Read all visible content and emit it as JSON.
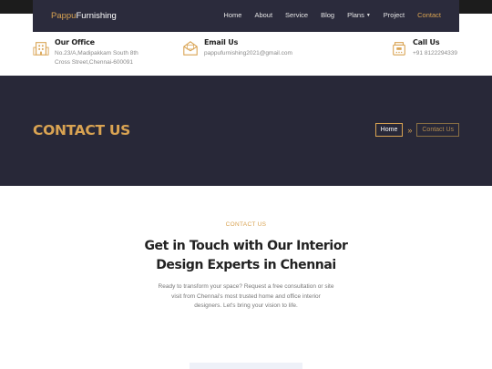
{
  "nav": {
    "brand_part1": "Pappu",
    "brand_part2": "Furnishing",
    "items": [
      "Home",
      "About",
      "Service",
      "Blog",
      "Plans",
      "Project",
      "Contact"
    ],
    "active": "Contact"
  },
  "info": {
    "office": {
      "title": "Our Office",
      "line1": "No.23/A,Madipakkam South 8th",
      "line2": "Cross Street,Chennai-600091",
      "icon": "building-icon"
    },
    "email": {
      "title": "Email Us",
      "value": "pappufurnishing2021@gmail.com",
      "icon": "envelope-icon"
    },
    "call": {
      "title": "Call Us",
      "value": "+91 8122294339",
      "icon": "phone-icon"
    }
  },
  "hero": {
    "title": "CONTACT US",
    "breadcrumb": [
      "Home",
      "Contact Us"
    ]
  },
  "section": {
    "tag": "CONTACT US",
    "title_line1": "Get in Touch with Our Interior",
    "title_line2": "Design Experts in Chennai",
    "body_lines": [
      "Ready to transform your space? Request a free consultation or site",
      "visit from Chennai's most trusted home and office interior",
      "designers. Let's bring your vision to life."
    ]
  },
  "colors": {
    "accent": "#d9a352",
    "navbar_bg": "#2b2b3c",
    "hero_bg": "#282838"
  }
}
